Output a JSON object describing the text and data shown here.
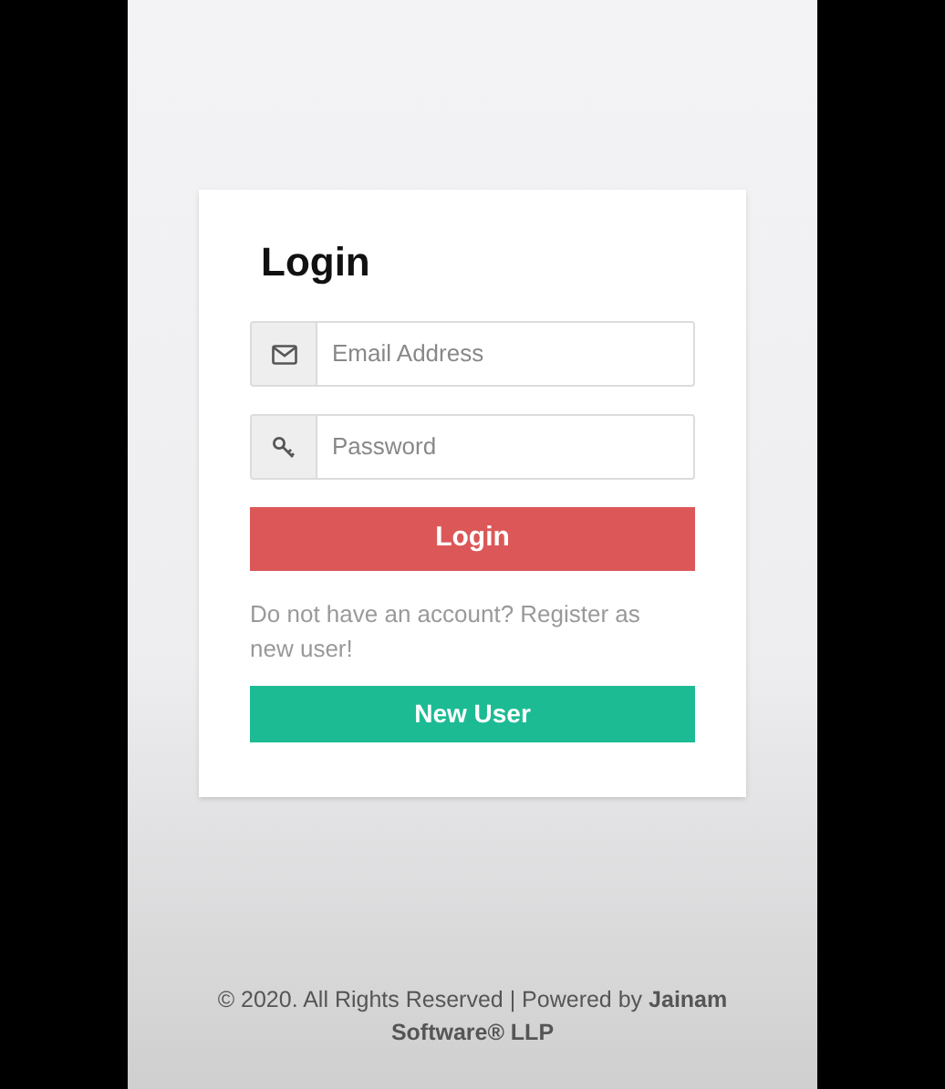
{
  "login_card": {
    "title": "Login",
    "fields": [
      {
        "kind": "email",
        "placeholder": "Email Address"
      },
      {
        "kind": "password",
        "placeholder": "Password"
      }
    ],
    "login_button": "Login",
    "register_prompt": "Do not have an account? Register as new user!",
    "new_user_button": "New User"
  },
  "footer": "© 2020. All Rights Reserved | Powered by **Jainam Software® LLP**"
}
